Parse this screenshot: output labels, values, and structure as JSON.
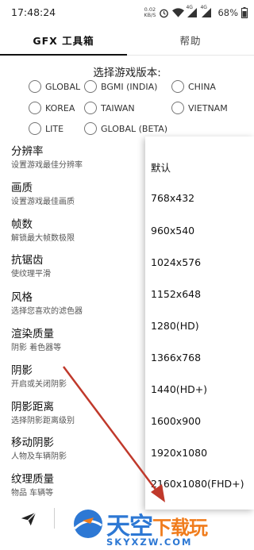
{
  "status_bar": {
    "time": "17:48:24",
    "net_speed_value": "0.02",
    "net_speed_unit": "KB/S",
    "signal_label_1": "4G",
    "signal_label_2": "4G",
    "battery": "68%",
    "icons": [
      "alarm-icon",
      "wifi-icon",
      "signal-icon",
      "signal-icon",
      "battery-icon"
    ]
  },
  "tabs": [
    {
      "label": "GFX 工具箱",
      "active": true
    },
    {
      "label": "帮助",
      "active": false
    }
  ],
  "version_picker": {
    "title": "选择游戏版本:",
    "options": [
      {
        "label": "GLOBAL"
      },
      {
        "label": "BGMI (INDIA)"
      },
      {
        "label": "CHINA"
      },
      {
        "label": "KOREA"
      },
      {
        "label": "TAIWAN"
      },
      {
        "label": "VIETNAM"
      },
      {
        "label": "LITE"
      },
      {
        "label": "GLOBAL (BETA)"
      }
    ]
  },
  "settings": [
    {
      "title": "分辨率",
      "desc": "设置游戏最佳分辨率"
    },
    {
      "title": "画质",
      "desc": "设置游戏最佳画质"
    },
    {
      "title": "帧数",
      "desc": "解锁最大帧数极限"
    },
    {
      "title": "抗锯齿",
      "desc": "使纹理平滑"
    },
    {
      "title": "风格",
      "desc": "选择您喜欢的滤色器"
    },
    {
      "title": "渲染质量",
      "desc": "阴影 着色器等"
    },
    {
      "title": "阴影",
      "desc": "开启或关闭阴影"
    },
    {
      "title": "阴影距离",
      "desc": "选择阴影距离级别"
    },
    {
      "title": "移动阴影",
      "desc": "人物及车辆阴影"
    },
    {
      "title": "纹理质量",
      "desc": "物品 车辆等"
    }
  ],
  "resolution_dropdown": {
    "options": [
      "默认",
      "768x432",
      "960x540",
      "1024x576",
      "1152x648",
      "1280(HD)",
      "1366x768",
      "1440(HD+)",
      "1600x900",
      "1920x1080",
      "2160x1080(FHD+)"
    ]
  },
  "bottom_bar": {
    "icons": [
      "send-icon"
    ]
  },
  "watermark": {
    "main_text": "天空",
    "accent_text": "下载玩",
    "sub_text": "SKYXZW.COM"
  },
  "colors": {
    "arrow": "#c0392b",
    "watermark_blue": "#2d78d4",
    "watermark_orange": "#f07c1c",
    "radio_border": "#757575"
  }
}
